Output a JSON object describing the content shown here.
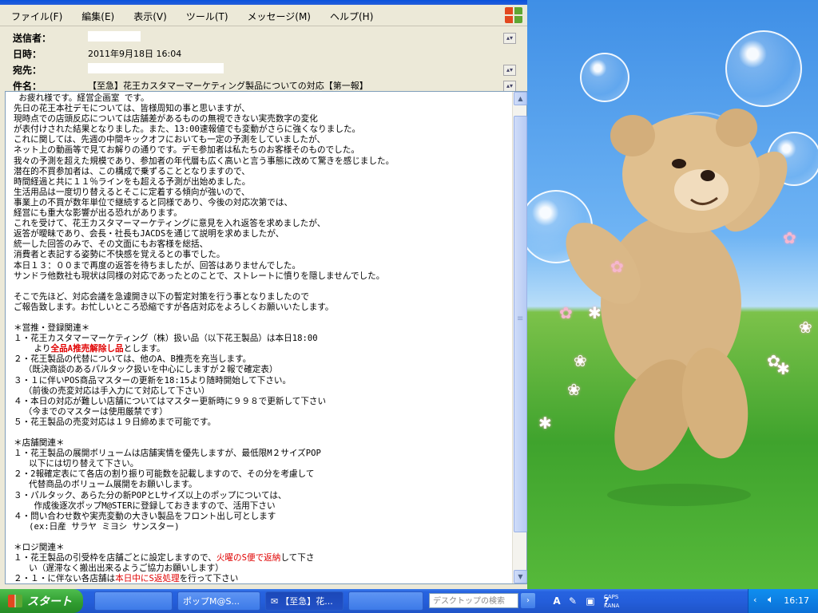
{
  "menu": [
    "ファイル(F)",
    "編集(E)",
    "表示(V)",
    "ツール(T)",
    "メッセージ(M)",
    "ヘルプ(H)"
  ],
  "headers": {
    "from_label": "送信者：",
    "date_label": "日時：",
    "date_value": "2011年9月18日 16:04",
    "to_label": "宛先：",
    "subject_label": "件名：",
    "subject_value": "【至急】花王カスタマーマーケティング製品についての対応【第一報】"
  },
  "body": {
    "p1": " お疲れ様です。経営企画室 です。\n先日の花王本社デモについては、皆様周知の事と思いますが、\n現時点での店頭反応については店舗差があるものの無視できない実売数字の変化\nが表付けされた結果となりました。また、13:00速報値でも変動がさらに強くなりました。\nこれに関しては、先週の中間キックオフにおいても一定の予測をしていましたが、\nネット上の動画等で見てお解りの通りです。デモ参加者は私たちのお客様そのものでした。\n我々の予測を超えた規模であり、参加者の年代層も広く高いと言う事態に改めて驚きを感じました。\n潜在的不買参加者は、この構成で乗ずることとなりますので、\n時間経過と共に１１％ラインをも超える予測が出始めました。\n生活用品は一度切り替えるとそこに定着する傾向が強いので、\n事業上の不買が数年単位で継続すると同様であり、今後の対応次第では、\n経営にも重大な影響が出る恐れがあります。\nこれを受けて、花王カスタマーマーケティングに意見を入れ返答を求めましたが、\n返答が曖昧であり、会長・社長もJACDSを通じて説明を求めましたが、\n統一した回答のみで、その文面にもお客様を総括、\n消費者と表記する姿勢に不快感を覚えるとの事でした。\n本日１３：００まで再度の返答を待ちましたが、回答はありませんでした。\nサンドラ他数社も現状は同様の対応であったとのことで、ストレートに憤りを隠しませんでした。\n\nそこで先ほど、対応会議を急遽開き以下の暫定対策を行う事となりましたので\nご報告致します。お忙しいところ恐縮ですが各店対応をよろしくお願いいたします。\n\n＊営推・登録関連＊\n１・花王カスタマーマーケティング（株）扱い品（以下花王製品）は本日18:00\n    より",
    "p1_red": "全品A推売解除し品",
    "p2": "とします。\n２・花王製品の代替については、他のA、B推売を充当します。\n  （既決商談のあるパルタック扱いを中心にしますが２報で確定表）\n３・１に伴いPOS商品マスターの更新を18:15より随時開始して下さい。\n  （前後の売変対応は手入力にて対応して下さい）\n４・本日の対応が難しい店舗についてはマスター更新時に９９８で更新して下さい\n  （今までのマスターは使用厳禁です）\n５・花王製品の売変対応は１９日締めまで可能です。\n\n＊店舗関連＊\n１・花王製品の展開ボリュームは店舗実情を優先しますが、最低限M２サイズPOP\n   以下には切り替えて下さい。\n２・2報確定表にて各店の割り振り可能数を記載しますので、その分を考慮して\n   代替商品のボリューム展開をお願いします。\n３・パルタック、あらた分の新POPとLサイズ以上のポップについては、\n    作成後逐次ポップM@STERに登録しておきますので、活用下さい\n４・問い合わせ数や実売変動の大きい製品をフロント出し可とします\n   (ex:日産 サラヤ ミヨシ サンスター)\n\n＊ロジ関連＊\n１・花王製品の引受枠を店舗ごとに設定しますので、",
    "p2_red": "火曜のS便で返納",
    "p3": "して下さ\n   い（遅滞なく搬出出来るようご協力お願いします）\n２・１・に伴ない各店舗は",
    "p3_red": "本日中にS返処理",
    "p4": "を行って下さい"
  },
  "taskbar": {
    "start_label": "スタート",
    "buttons": [
      "",
      "ポップM@S...",
      "【至急】花...",
      ""
    ],
    "desktop_search_placeholder": "デスクトップの検索",
    "caps": "CAPS",
    "kana": "KANA",
    "clock": "16:17"
  }
}
